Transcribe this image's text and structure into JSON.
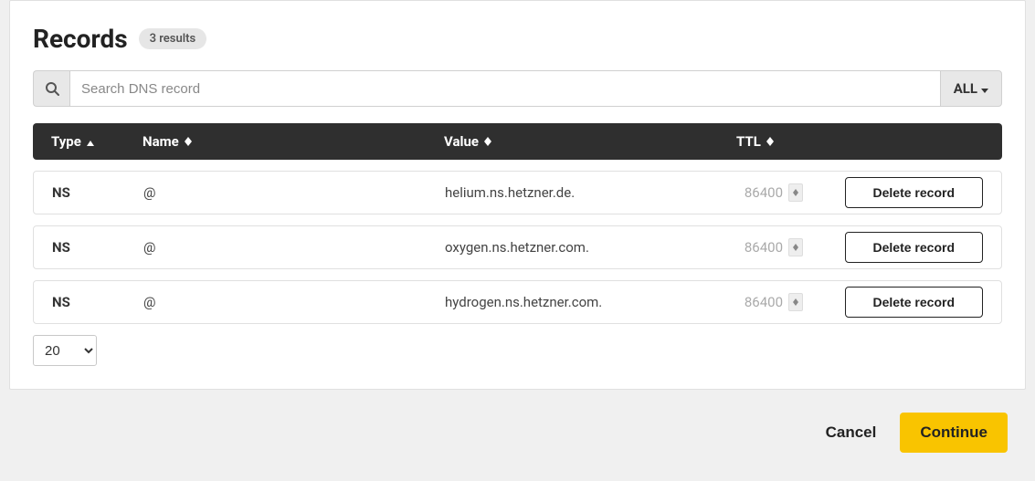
{
  "title": "Records",
  "results_badge": "3 results",
  "search": {
    "placeholder": "Search DNS record",
    "filter_label": "ALL"
  },
  "columns": {
    "type": "Type",
    "name": "Name",
    "value": "Value",
    "ttl": "TTL"
  },
  "records": [
    {
      "type": "NS",
      "name": "@",
      "value": "helium.ns.hetzner.de.",
      "ttl": "86400"
    },
    {
      "type": "NS",
      "name": "@",
      "value": "oxygen.ns.hetzner.com.",
      "ttl": "86400"
    },
    {
      "type": "NS",
      "name": "@",
      "value": "hydrogen.ns.hetzner.com.",
      "ttl": "86400"
    }
  ],
  "delete_label": "Delete record",
  "page_size_options": [
    "20"
  ],
  "page_size_selected": "20",
  "footer": {
    "cancel": "Cancel",
    "continue": "Continue"
  }
}
